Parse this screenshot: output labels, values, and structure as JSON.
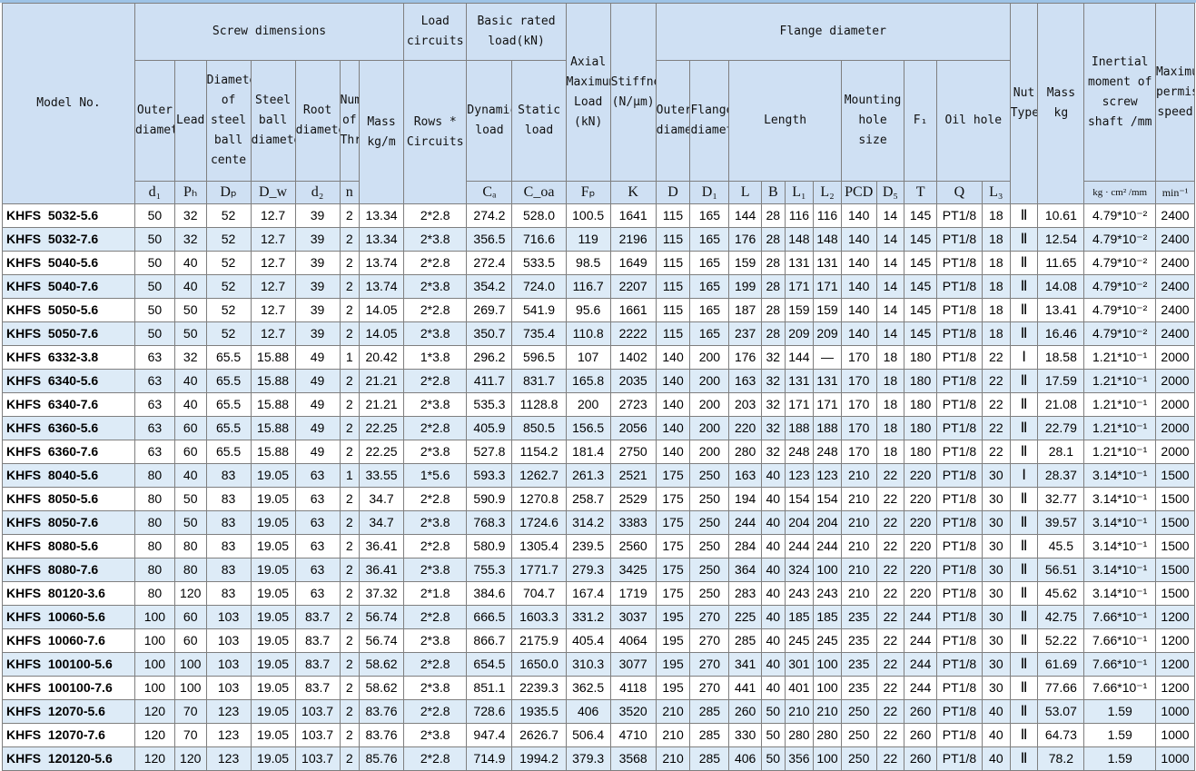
{
  "headers": {
    "model_no": "Model No.",
    "screw_dimensions": "Screw dimensions",
    "load_circuits": "Load circuits",
    "basic_rated_load": "Basic rated load(kN)",
    "axial_max_load": "Axial Maximum Load (kN)",
    "stiffness": "Stiffness (N/μm)",
    "flange_diameter": "Flange diameter",
    "inertial_moment": "Inertial moment of screw shaft /mm",
    "max_speed": "Maximum permissible speed",
    "outer_diameter": "Outer diameter",
    "lead": "Lead",
    "diameter_steel_ball_center": "Diameter of steel ball cente",
    "steel_ball_diameter": "Steel ball diameter",
    "root_diameter": "Root diameter",
    "number_of_threads": "Number of Thre",
    "mass_kgm": "Mass kg/m",
    "rows_circuits": "Rows * Circuits",
    "dynamic_load": "Dynamic load",
    "static_load": "Static load",
    "flange_outer_diameter": "Outer diameter",
    "flange_diameter_sub": "Flange diameter",
    "length": "Length",
    "mounting_hole_size": "Mounting hole size",
    "f1": "F₁",
    "oil_hole": "Oil hole",
    "nut_type": "Nut Type",
    "mass_kg": "Mass kg",
    "sym_d1": "d₁",
    "sym_ph": "Pₕ",
    "sym_dp": "Dₚ",
    "sym_dw": "D_w",
    "sym_d2": "d₂",
    "sym_n": "n",
    "sym_ca": "Cₐ",
    "sym_coa": "C_oa",
    "sym_fp": "Fₚ",
    "sym_k": "K",
    "sym_D": "D",
    "sym_D1": "D₁",
    "sym_L": "L",
    "sym_B": "B",
    "sym_L1": "L₁",
    "sym_L2": "L₂",
    "sym_pcd": "PCD",
    "sym_d5": "D₅",
    "sym_T": "T",
    "sym_Q": "Q",
    "sym_L3": "L₃",
    "unit_inertia": "kg · cm² /mm",
    "unit_speed": "min⁻¹"
  },
  "rows": [
    [
      "KHFS  5032-5.6",
      "50",
      "32",
      "52",
      "12.7",
      "39",
      "2",
      "13.34",
      "2*2.8",
      "274.2",
      "528.0",
      "100.5",
      "1641",
      "115",
      "165",
      "144",
      "28",
      "116",
      "116",
      "140",
      "14",
      "145",
      "PT1/8",
      "18",
      "Ⅱ",
      "10.61",
      "4.79*10⁻²",
      "2400"
    ],
    [
      "KHFS  5032-7.6",
      "50",
      "32",
      "52",
      "12.7",
      "39",
      "2",
      "13.34",
      "2*3.8",
      "356.5",
      "716.6",
      "119",
      "2196",
      "115",
      "165",
      "176",
      "28",
      "148",
      "148",
      "140",
      "14",
      "145",
      "PT1/8",
      "18",
      "Ⅱ",
      "12.54",
      "4.79*10⁻²",
      "2400"
    ],
    [
      "KHFS  5040-5.6",
      "50",
      "40",
      "52",
      "12.7",
      "39",
      "2",
      "13.74",
      "2*2.8",
      "272.4",
      "533.5",
      "98.5",
      "1649",
      "115",
      "165",
      "159",
      "28",
      "131",
      "131",
      "140",
      "14",
      "145",
      "PT1/8",
      "18",
      "Ⅱ",
      "11.65",
      "4.79*10⁻²",
      "2400"
    ],
    [
      "KHFS  5040-7.6",
      "50",
      "40",
      "52",
      "12.7",
      "39",
      "2",
      "13.74",
      "2*3.8",
      "354.2",
      "724.0",
      "116.7",
      "2207",
      "115",
      "165",
      "199",
      "28",
      "171",
      "171",
      "140",
      "14",
      "145",
      "PT1/8",
      "18",
      "Ⅱ",
      "14.08",
      "4.79*10⁻²",
      "2400"
    ],
    [
      "KHFS  5050-5.6",
      "50",
      "50",
      "52",
      "12.7",
      "39",
      "2",
      "14.05",
      "2*2.8",
      "269.7",
      "541.9",
      "95.6",
      "1661",
      "115",
      "165",
      "187",
      "28",
      "159",
      "159",
      "140",
      "14",
      "145",
      "PT1/8",
      "18",
      "Ⅱ",
      "13.41",
      "4.79*10⁻²",
      "2400"
    ],
    [
      "KHFS  5050-7.6",
      "50",
      "50",
      "52",
      "12.7",
      "39",
      "2",
      "14.05",
      "2*3.8",
      "350.7",
      "735.4",
      "110.8",
      "2222",
      "115",
      "165",
      "237",
      "28",
      "209",
      "209",
      "140",
      "14",
      "145",
      "PT1/8",
      "18",
      "Ⅱ",
      "16.46",
      "4.79*10⁻²",
      "2400"
    ],
    [
      "KHFS  6332-3.8",
      "63",
      "32",
      "65.5",
      "15.88",
      "49",
      "1",
      "20.42",
      "1*3.8",
      "296.2",
      "596.5",
      "107",
      "1402",
      "140",
      "200",
      "176",
      "32",
      "144",
      "—",
      "170",
      "18",
      "180",
      "PT1/8",
      "22",
      "Ⅰ",
      "18.58",
      "1.21*10⁻¹",
      "2000"
    ],
    [
      "KHFS  6340-5.6",
      "63",
      "40",
      "65.5",
      "15.88",
      "49",
      "2",
      "21.21",
      "2*2.8",
      "411.7",
      "831.7",
      "165.8",
      "2035",
      "140",
      "200",
      "163",
      "32",
      "131",
      "131",
      "170",
      "18",
      "180",
      "PT1/8",
      "22",
      "Ⅱ",
      "17.59",
      "1.21*10⁻¹",
      "2000"
    ],
    [
      "KHFS  6340-7.6",
      "63",
      "40",
      "65.5",
      "15.88",
      "49",
      "2",
      "21.21",
      "2*3.8",
      "535.3",
      "1128.8",
      "200",
      "2723",
      "140",
      "200",
      "203",
      "32",
      "171",
      "171",
      "170",
      "18",
      "180",
      "PT1/8",
      "22",
      "Ⅱ",
      "21.08",
      "1.21*10⁻¹",
      "2000"
    ],
    [
      "KHFS  6360-5.6",
      "63",
      "60",
      "65.5",
      "15.88",
      "49",
      "2",
      "22.25",
      "2*2.8",
      "405.9",
      "850.5",
      "156.5",
      "2056",
      "140",
      "200",
      "220",
      "32",
      "188",
      "188",
      "170",
      "18",
      "180",
      "PT1/8",
      "22",
      "Ⅱ",
      "22.79",
      "1.21*10⁻¹",
      "2000"
    ],
    [
      "KHFS  6360-7.6",
      "63",
      "60",
      "65.5",
      "15.88",
      "49",
      "2",
      "22.25",
      "2*3.8",
      "527.8",
      "1154.2",
      "181.4",
      "2750",
      "140",
      "200",
      "280",
      "32",
      "248",
      "248",
      "170",
      "18",
      "180",
      "PT1/8",
      "22",
      "Ⅱ",
      "28.1",
      "1.21*10⁻¹",
      "2000"
    ],
    [
      "KHFS  8040-5.6",
      "80",
      "40",
      "83",
      "19.05",
      "63",
      "1",
      "33.55",
      "1*5.6",
      "593.3",
      "1262.7",
      "261.3",
      "2521",
      "175",
      "250",
      "163",
      "40",
      "123",
      "123",
      "210",
      "22",
      "220",
      "PT1/8",
      "30",
      "Ⅰ",
      "28.37",
      "3.14*10⁻¹",
      "1500"
    ],
    [
      "KHFS  8050-5.6",
      "80",
      "50",
      "83",
      "19.05",
      "63",
      "2",
      "34.7",
      "2*2.8",
      "590.9",
      "1270.8",
      "258.7",
      "2529",
      "175",
      "250",
      "194",
      "40",
      "154",
      "154",
      "210",
      "22",
      "220",
      "PT1/8",
      "30",
      "Ⅱ",
      "32.77",
      "3.14*10⁻¹",
      "1500"
    ],
    [
      "KHFS  8050-7.6",
      "80",
      "50",
      "83",
      "19.05",
      "63",
      "2",
      "34.7",
      "2*3.8",
      "768.3",
      "1724.6",
      "314.2",
      "3383",
      "175",
      "250",
      "244",
      "40",
      "204",
      "204",
      "210",
      "22",
      "220",
      "PT1/8",
      "30",
      "Ⅱ",
      "39.57",
      "3.14*10⁻¹",
      "1500"
    ],
    [
      "KHFS  8080-5.6",
      "80",
      "80",
      "83",
      "19.05",
      "63",
      "2",
      "36.41",
      "2*2.8",
      "580.9",
      "1305.4",
      "239.5",
      "2560",
      "175",
      "250",
      "284",
      "40",
      "244",
      "244",
      "210",
      "22",
      "220",
      "PT1/8",
      "30",
      "Ⅱ",
      "45.5",
      "3.14*10⁻¹",
      "1500"
    ],
    [
      "KHFS  8080-7.6",
      "80",
      "80",
      "83",
      "19.05",
      "63",
      "2",
      "36.41",
      "2*3.8",
      "755.3",
      "1771.7",
      "279.3",
      "3425",
      "175",
      "250",
      "364",
      "40",
      "324",
      "100",
      "210",
      "22",
      "220",
      "PT1/8",
      "30",
      "Ⅱ",
      "56.51",
      "3.14*10⁻¹",
      "1500"
    ],
    [
      "KHFS  80120-3.6",
      "80",
      "120",
      "83",
      "19.05",
      "63",
      "2",
      "37.32",
      "2*1.8",
      "384.6",
      "704.7",
      "167.4",
      "1719",
      "175",
      "250",
      "283",
      "40",
      "243",
      "243",
      "210",
      "22",
      "220",
      "PT1/8",
      "30",
      "Ⅱ",
      "45.62",
      "3.14*10⁻¹",
      "1500"
    ],
    [
      "KHFS  10060-5.6",
      "100",
      "60",
      "103",
      "19.05",
      "83.7",
      "2",
      "56.74",
      "2*2.8",
      "666.5",
      "1603.3",
      "331.2",
      "3037",
      "195",
      "270",
      "225",
      "40",
      "185",
      "185",
      "235",
      "22",
      "244",
      "PT1/8",
      "30",
      "Ⅱ",
      "42.75",
      "7.66*10⁻¹",
      "1200"
    ],
    [
      "KHFS  10060-7.6",
      "100",
      "60",
      "103",
      "19.05",
      "83.7",
      "2",
      "56.74",
      "2*3.8",
      "866.7",
      "2175.9",
      "405.4",
      "4064",
      "195",
      "270",
      "285",
      "40",
      "245",
      "245",
      "235",
      "22",
      "244",
      "PT1/8",
      "30",
      "Ⅱ",
      "52.22",
      "7.66*10⁻¹",
      "1200"
    ],
    [
      "KHFS  100100-5.6",
      "100",
      "100",
      "103",
      "19.05",
      "83.7",
      "2",
      "58.62",
      "2*2.8",
      "654.5",
      "1650.0",
      "310.3",
      "3077",
      "195",
      "270",
      "341",
      "40",
      "301",
      "100",
      "235",
      "22",
      "244",
      "PT1/8",
      "30",
      "Ⅱ",
      "61.69",
      "7.66*10⁻¹",
      "1200"
    ],
    [
      "KHFS  100100-7.6",
      "100",
      "100",
      "103",
      "19.05",
      "83.7",
      "2",
      "58.62",
      "2*3.8",
      "851.1",
      "2239.3",
      "362.5",
      "4118",
      "195",
      "270",
      "441",
      "40",
      "401",
      "100",
      "235",
      "22",
      "244",
      "PT1/8",
      "30",
      "Ⅱ",
      "77.66",
      "7.66*10⁻¹",
      "1200"
    ],
    [
      "KHFS  12070-5.6",
      "120",
      "70",
      "123",
      "19.05",
      "103.7",
      "2",
      "83.76",
      "2*2.8",
      "728.6",
      "1935.5",
      "406",
      "3520",
      "210",
      "285",
      "260",
      "50",
      "210",
      "210",
      "250",
      "22",
      "260",
      "PT1/8",
      "40",
      "Ⅱ",
      "53.07",
      "1.59",
      "1000"
    ],
    [
      "KHFS  12070-7.6",
      "120",
      "70",
      "123",
      "19.05",
      "103.7",
      "2",
      "83.76",
      "2*3.8",
      "947.4",
      "2626.7",
      "506.4",
      "4710",
      "210",
      "285",
      "330",
      "50",
      "280",
      "280",
      "250",
      "22",
      "260",
      "PT1/8",
      "40",
      "Ⅱ",
      "64.73",
      "1.59",
      "1000"
    ],
    [
      "KHFS  120120-5.6",
      "120",
      "120",
      "123",
      "19.05",
      "103.7",
      "2",
      "85.76",
      "2*2.8",
      "714.9",
      "1994.2",
      "379.3",
      "3568",
      "210",
      "285",
      "406",
      "50",
      "356",
      "100",
      "250",
      "22",
      "260",
      "PT1/8",
      "40",
      "Ⅱ",
      "78.2",
      "1.59",
      "1000"
    ]
  ]
}
